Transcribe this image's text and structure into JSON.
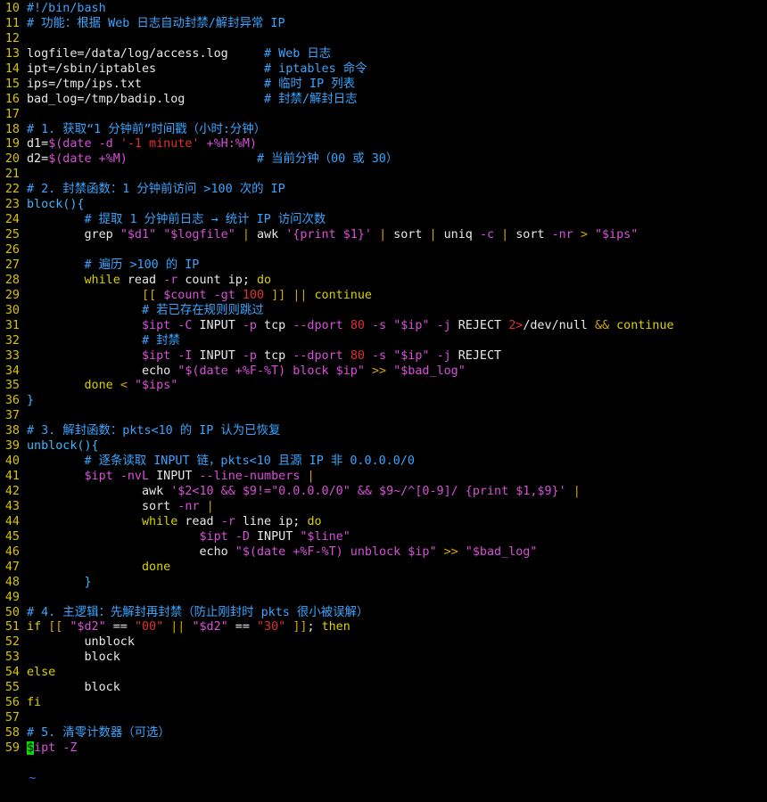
{
  "editor": {
    "cursor_char": "$",
    "tilde": "~",
    "lines": [
      {
        "n": "10",
        "segs": [
          [
            "c-comment",
            "#!/bin/bash"
          ]
        ]
      },
      {
        "n": "11",
        "segs": [
          [
            "c-comment",
            "# 功能：根据 Web 日志自动封禁/解封异常 IP"
          ]
        ]
      },
      {
        "n": "12",
        "segs": []
      },
      {
        "n": "13",
        "segs": [
          [
            "c-plain",
            "logfile=/data/log/access.log     "
          ],
          [
            "c-comment",
            "# Web 日志"
          ]
        ]
      },
      {
        "n": "14",
        "segs": [
          [
            "c-plain",
            "ipt=/sbin/iptables               "
          ],
          [
            "c-comment",
            "# iptables 命令"
          ]
        ]
      },
      {
        "n": "15",
        "segs": [
          [
            "c-plain",
            "ips=/tmp/ips.txt                 "
          ],
          [
            "c-comment",
            "# 临时 IP 列表"
          ]
        ]
      },
      {
        "n": "16",
        "segs": [
          [
            "c-plain",
            "bad_log=/tmp/badip.log           "
          ],
          [
            "c-comment",
            "# 封禁/解封日志"
          ]
        ]
      },
      {
        "n": "17",
        "segs": []
      },
      {
        "n": "18",
        "segs": [
          [
            "c-comment",
            "# 1. 获取“1 分钟前”时间戳（小时:分钟）"
          ]
        ]
      },
      {
        "n": "19",
        "segs": [
          [
            "c-plain",
            "d1="
          ],
          [
            "c-var",
            "$(date -d "
          ],
          [
            "c-num",
            "'-1 minute'"
          ],
          [
            "c-var",
            " +%H:%M)"
          ]
        ]
      },
      {
        "n": "20",
        "segs": [
          [
            "c-plain",
            "d2="
          ],
          [
            "c-var",
            "$(date +%M)"
          ],
          [
            "c-plain",
            "                  "
          ],
          [
            "c-comment",
            "# 当前分钟（00 或 30）"
          ]
        ]
      },
      {
        "n": "21",
        "segs": []
      },
      {
        "n": "22",
        "segs": [
          [
            "c-comment",
            "# 2. 封禁函数：1 分钟前访问 >100 次的 IP"
          ]
        ]
      },
      {
        "n": "23",
        "segs": [
          [
            "c-paren",
            "block(){"
          ]
        ]
      },
      {
        "n": "24",
        "segs": [
          [
            "c-plain",
            "        "
          ],
          [
            "c-comment",
            "# 提取 1 分钟前日志 → 统计 IP 访问次数"
          ]
        ]
      },
      {
        "n": "25",
        "segs": [
          [
            "c-plain",
            "        grep "
          ],
          [
            "c-str",
            "\"$d1\""
          ],
          [
            "c-plain",
            " "
          ],
          [
            "c-str",
            "\"$logfile\""
          ],
          [
            "c-plain",
            " "
          ],
          [
            "c-op",
            "|"
          ],
          [
            "c-plain",
            " awk "
          ],
          [
            "c-str",
            "'{print $1}'"
          ],
          [
            "c-plain",
            " "
          ],
          [
            "c-op",
            "|"
          ],
          [
            "c-plain",
            " sort "
          ],
          [
            "c-op",
            "|"
          ],
          [
            "c-plain",
            " uniq "
          ],
          [
            "c-flag",
            "-c"
          ],
          [
            "c-plain",
            " "
          ],
          [
            "c-op",
            "|"
          ],
          [
            "c-plain",
            " sort "
          ],
          [
            "c-flag",
            "-nr"
          ],
          [
            "c-plain",
            " "
          ],
          [
            "c-op",
            ">"
          ],
          [
            "c-plain",
            " "
          ],
          [
            "c-str",
            "\"$ips\""
          ]
        ]
      },
      {
        "n": "26",
        "segs": []
      },
      {
        "n": "27",
        "segs": [
          [
            "c-plain",
            "        "
          ],
          [
            "c-comment",
            "# 遍历 >100 的 IP"
          ]
        ]
      },
      {
        "n": "28",
        "segs": [
          [
            "c-kw",
            "        while"
          ],
          [
            "c-plain",
            " read "
          ],
          [
            "c-flag",
            "-r"
          ],
          [
            "c-plain",
            " count ip; "
          ],
          [
            "c-kw",
            "do"
          ]
        ]
      },
      {
        "n": "29",
        "segs": [
          [
            "c-plain",
            "                "
          ],
          [
            "c-op",
            "[["
          ],
          [
            "c-plain",
            " "
          ],
          [
            "c-var",
            "$count"
          ],
          [
            "c-plain",
            " "
          ],
          [
            "c-flag",
            "-gt"
          ],
          [
            "c-plain",
            " "
          ],
          [
            "c-num",
            "100"
          ],
          [
            "c-plain",
            " "
          ],
          [
            "c-op",
            "]]"
          ],
          [
            "c-plain",
            " "
          ],
          [
            "c-op",
            "||"
          ],
          [
            "c-plain",
            " "
          ],
          [
            "c-kw",
            "continue"
          ]
        ]
      },
      {
        "n": "30",
        "segs": [
          [
            "c-plain",
            "                "
          ],
          [
            "c-comment",
            "# 若已存在规则则跳过"
          ]
        ]
      },
      {
        "n": "31",
        "segs": [
          [
            "c-plain",
            "                "
          ],
          [
            "c-var",
            "$ipt"
          ],
          [
            "c-plain",
            " "
          ],
          [
            "c-flag",
            "-C"
          ],
          [
            "c-plain",
            " INPUT "
          ],
          [
            "c-flag",
            "-p"
          ],
          [
            "c-plain",
            " tcp "
          ],
          [
            "c-flag",
            "--dport"
          ],
          [
            "c-plain",
            " "
          ],
          [
            "c-num",
            "80"
          ],
          [
            "c-plain",
            " "
          ],
          [
            "c-flag",
            "-s"
          ],
          [
            "c-plain",
            " "
          ],
          [
            "c-str",
            "\"$ip\""
          ],
          [
            "c-plain",
            " "
          ],
          [
            "c-flag",
            "-j"
          ],
          [
            "c-plain",
            " REJECT "
          ],
          [
            "c-redir",
            "2>"
          ],
          [
            "c-plain",
            "/dev/null "
          ],
          [
            "c-op",
            "&&"
          ],
          [
            "c-plain",
            " "
          ],
          [
            "c-kw",
            "continue"
          ]
        ]
      },
      {
        "n": "32",
        "segs": [
          [
            "c-plain",
            "                "
          ],
          [
            "c-comment",
            "# 封禁"
          ]
        ]
      },
      {
        "n": "33",
        "segs": [
          [
            "c-plain",
            "                "
          ],
          [
            "c-var",
            "$ipt"
          ],
          [
            "c-plain",
            " "
          ],
          [
            "c-flag",
            "-I"
          ],
          [
            "c-plain",
            " INPUT "
          ],
          [
            "c-flag",
            "-p"
          ],
          [
            "c-plain",
            " tcp "
          ],
          [
            "c-flag",
            "--dport"
          ],
          [
            "c-plain",
            " "
          ],
          [
            "c-num",
            "80"
          ],
          [
            "c-plain",
            " "
          ],
          [
            "c-flag",
            "-s"
          ],
          [
            "c-plain",
            " "
          ],
          [
            "c-str",
            "\"$ip\""
          ],
          [
            "c-plain",
            " "
          ],
          [
            "c-flag",
            "-j"
          ],
          [
            "c-plain",
            " REJECT"
          ]
        ]
      },
      {
        "n": "34",
        "segs": [
          [
            "c-plain",
            "                echo "
          ],
          [
            "c-str",
            "\"$(date +%F-%T) block $ip\""
          ],
          [
            "c-plain",
            " "
          ],
          [
            "c-op",
            ">>"
          ],
          [
            "c-plain",
            " "
          ],
          [
            "c-str",
            "\"$bad_log\""
          ]
        ]
      },
      {
        "n": "35",
        "segs": [
          [
            "c-kw",
            "        done"
          ],
          [
            "c-plain",
            " "
          ],
          [
            "c-op",
            "<"
          ],
          [
            "c-plain",
            " "
          ],
          [
            "c-str",
            "\"$ips\""
          ]
        ]
      },
      {
        "n": "36",
        "segs": [
          [
            "c-brace",
            "}"
          ]
        ]
      },
      {
        "n": "37",
        "segs": []
      },
      {
        "n": "38",
        "segs": [
          [
            "c-comment",
            "# 3. 解封函数：pkts<10 的 IP 认为已恢复"
          ]
        ]
      },
      {
        "n": "39",
        "segs": [
          [
            "c-paren",
            "unblock(){"
          ]
        ]
      },
      {
        "n": "40",
        "segs": [
          [
            "c-plain",
            "        "
          ],
          [
            "c-comment",
            "# 逐条读取 INPUT 链，pkts<10 且源 IP 非 0.0.0.0/0"
          ]
        ]
      },
      {
        "n": "41",
        "segs": [
          [
            "c-plain",
            "        "
          ],
          [
            "c-var",
            "$ipt"
          ],
          [
            "c-plain",
            " "
          ],
          [
            "c-flag",
            "-nvL"
          ],
          [
            "c-plain",
            " INPUT "
          ],
          [
            "c-flag",
            "--line-numbers"
          ],
          [
            "c-plain",
            " "
          ],
          [
            "c-op",
            "|"
          ]
        ]
      },
      {
        "n": "42",
        "segs": [
          [
            "c-plain",
            "                awk "
          ],
          [
            "c-str",
            "'$2<10 && $9!=\"0.0.0.0/0\" && $9~/^[0-9]/ {print $1,$9}'"
          ],
          [
            "c-plain",
            " "
          ],
          [
            "c-op",
            "|"
          ]
        ]
      },
      {
        "n": "43",
        "segs": [
          [
            "c-plain",
            "                sort "
          ],
          [
            "c-flag",
            "-nr"
          ],
          [
            "c-plain",
            " "
          ],
          [
            "c-op",
            "|"
          ]
        ]
      },
      {
        "n": "44",
        "segs": [
          [
            "c-kw",
            "                while"
          ],
          [
            "c-plain",
            " read "
          ],
          [
            "c-flag",
            "-r"
          ],
          [
            "c-plain",
            " line ip; "
          ],
          [
            "c-kw",
            "do"
          ]
        ]
      },
      {
        "n": "45",
        "segs": [
          [
            "c-plain",
            "                        "
          ],
          [
            "c-var",
            "$ipt"
          ],
          [
            "c-plain",
            " "
          ],
          [
            "c-flag",
            "-D"
          ],
          [
            "c-plain",
            " INPUT "
          ],
          [
            "c-str",
            "\"$line\""
          ]
        ]
      },
      {
        "n": "46",
        "segs": [
          [
            "c-plain",
            "                        echo "
          ],
          [
            "c-str",
            "\"$(date +%F-%T) unblock $ip\""
          ],
          [
            "c-plain",
            " "
          ],
          [
            "c-op",
            ">>"
          ],
          [
            "c-plain",
            " "
          ],
          [
            "c-str",
            "\"$bad_log\""
          ]
        ]
      },
      {
        "n": "47",
        "segs": [
          [
            "c-kw",
            "                done"
          ]
        ]
      },
      {
        "n": "48",
        "segs": [
          [
            "c-plain",
            "        "
          ],
          [
            "c-brace",
            "}"
          ]
        ]
      },
      {
        "n": "49",
        "segs": []
      },
      {
        "n": "50",
        "segs": [
          [
            "c-comment",
            "# 4. 主逻辑：先解封再封禁（防止刚封时 pkts 很小被误解）"
          ]
        ]
      },
      {
        "n": "51",
        "segs": [
          [
            "c-kw",
            "if"
          ],
          [
            "c-plain",
            " "
          ],
          [
            "c-op",
            "[["
          ],
          [
            "c-plain",
            " "
          ],
          [
            "c-str",
            "\"$d2\""
          ],
          [
            "c-plain",
            " == "
          ],
          [
            "c-num",
            "\"00\""
          ],
          [
            "c-plain",
            " "
          ],
          [
            "c-op",
            "||"
          ],
          [
            "c-plain",
            " "
          ],
          [
            "c-str",
            "\"$d2\""
          ],
          [
            "c-plain",
            " == "
          ],
          [
            "c-num",
            "\"30\""
          ],
          [
            "c-plain",
            " "
          ],
          [
            "c-op",
            "]]"
          ],
          [
            "c-plain",
            "; "
          ],
          [
            "c-kw",
            "then"
          ]
        ]
      },
      {
        "n": "52",
        "segs": [
          [
            "c-plain",
            "        unblock"
          ]
        ]
      },
      {
        "n": "53",
        "segs": [
          [
            "c-plain",
            "        block"
          ]
        ]
      },
      {
        "n": "54",
        "segs": [
          [
            "c-kw",
            "else"
          ]
        ]
      },
      {
        "n": "55",
        "segs": [
          [
            "c-plain",
            "        block"
          ]
        ]
      },
      {
        "n": "56",
        "segs": [
          [
            "c-kw",
            "fi"
          ]
        ]
      },
      {
        "n": "57",
        "segs": []
      },
      {
        "n": "58",
        "segs": [
          [
            "c-comment",
            "# 5. 清零计数器（可选）"
          ]
        ]
      },
      {
        "n": "59",
        "segs": [
          [
            "cursor",
            "$"
          ],
          [
            "c-var",
            "ipt"
          ],
          [
            "c-plain",
            " "
          ],
          [
            "c-flag",
            "-Z"
          ]
        ]
      }
    ]
  }
}
